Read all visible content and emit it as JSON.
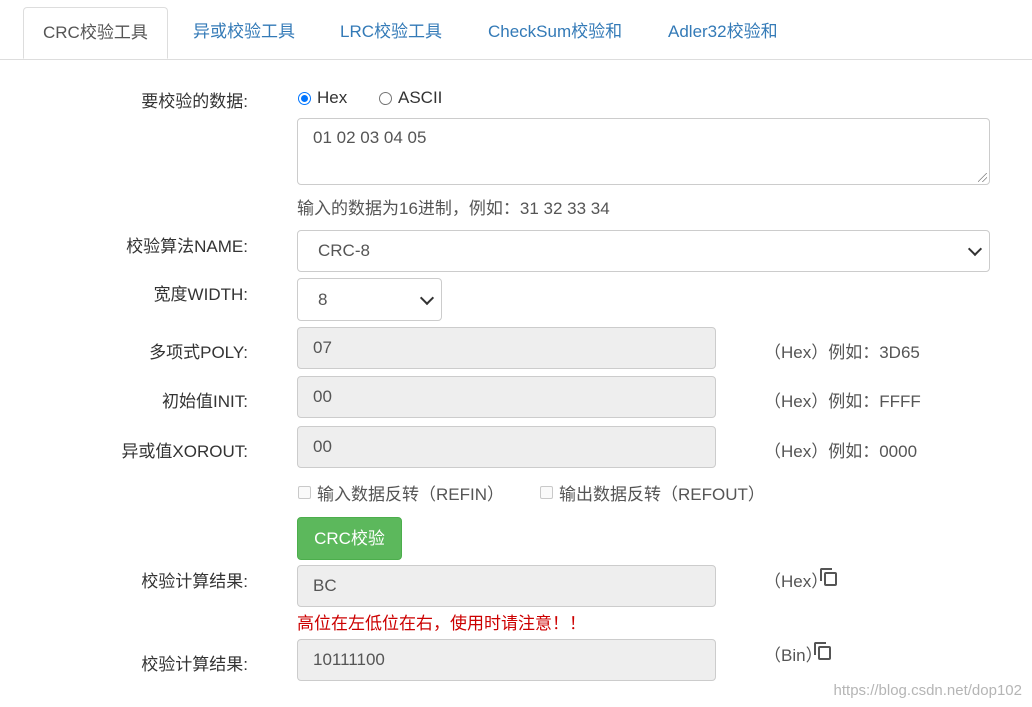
{
  "tabs": [
    {
      "label": "CRC校验工具"
    },
    {
      "label": "异或校验工具"
    },
    {
      "label": "LRC校验工具"
    },
    {
      "label": "CheckSum校验和"
    },
    {
      "label": "Adler32校验和"
    }
  ],
  "form": {
    "data_label": "要校验的数据:",
    "radio_hex": "Hex",
    "radio_ascii": "ASCII",
    "data_value": "01 02 03 04 05",
    "data_hint": "输入的数据为16进制，例如：31 32 33 34",
    "algo_label": "校验算法NAME:",
    "algo_value": "CRC-8",
    "width_label": "宽度WIDTH:",
    "width_value": "8",
    "poly_label": "多项式POLY:",
    "poly_value": "07",
    "poly_hint": "（Hex）例如：3D65",
    "init_label": "初始值INIT:",
    "init_value": "00",
    "init_hint": "（Hex）例如：FFFF",
    "xorout_label": "异或值XOROUT:",
    "xorout_value": "00",
    "xorout_hint": "（Hex）例如：0000",
    "refin_label": "输入数据反转（REFIN）",
    "refout_label": "输出数据反转（REFOUT）",
    "button_label": "CRC校验",
    "result_label": "校验计算结果:",
    "result_hex_value": "BC",
    "result_hex_unit": "（Hex）",
    "warning": "高位在左低位在右，使用时请注意！！",
    "result_bin_value": "10111100",
    "result_bin_unit": "（Bin）"
  },
  "watermark": "https://blog.csdn.net/dop102"
}
